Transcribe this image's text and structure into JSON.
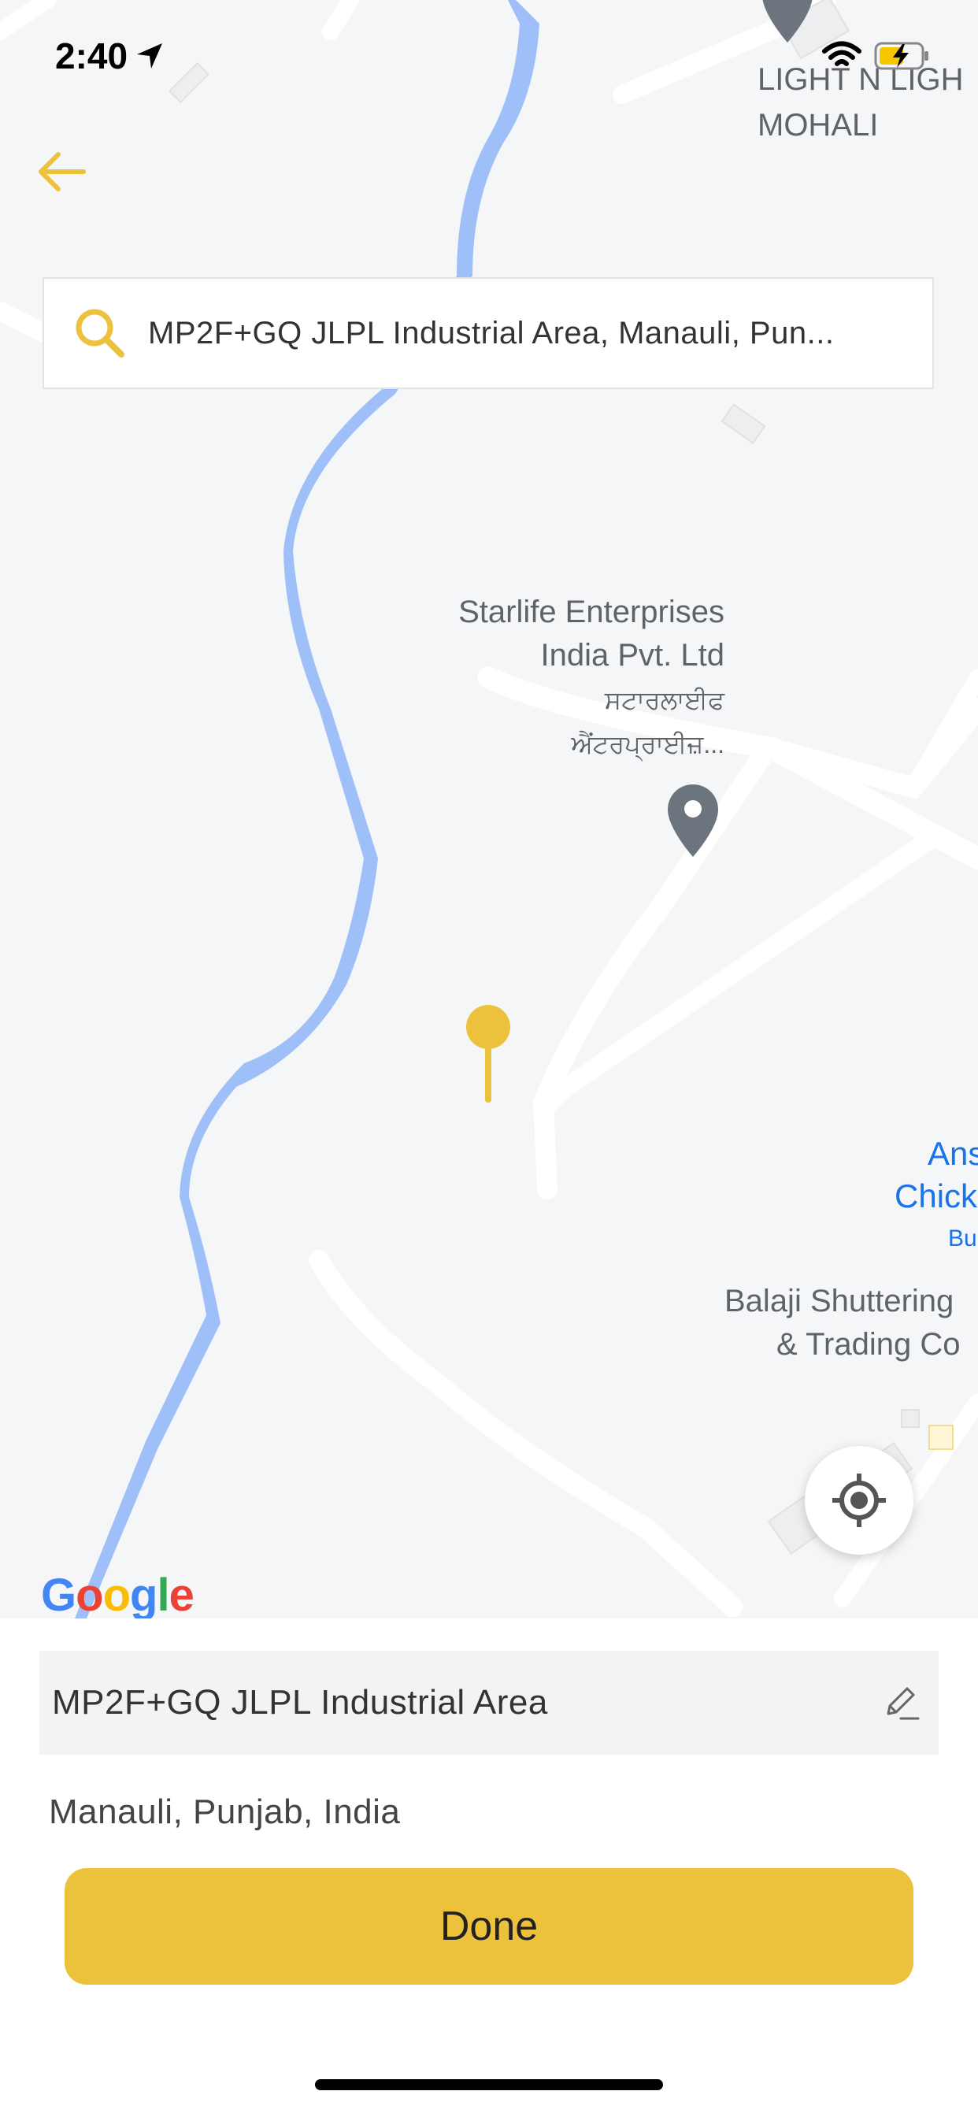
{
  "status_bar": {
    "time": "2:40",
    "location_arrow_icon": "location-arrow-icon",
    "wifi_icon": "wifi-icon",
    "battery_icon": "battery-charging-icon",
    "battery_color": "#f7c600"
  },
  "header": {
    "back_icon": "arrow-left-icon",
    "accent": "#ecc13c"
  },
  "search": {
    "icon": "search-icon",
    "value": "MP2F+GQ JLPL Industrial Area, Manauli, Pun..."
  },
  "map": {
    "labels": {
      "light_n_light": "LIGHT N LIGH",
      "mohali": "MOHALI",
      "starlife_line1": "Starlife Enterprises",
      "starlife_line2": "India Pvt. Ltd",
      "starlife_pa1": "ਸਟਾਰਲਾਈਫ",
      "starlife_pa2": "ਐਂਟਰਪ੍ਰਾਈਜ਼...",
      "ans_line1": "Ans",
      "ans_line2": "Chick",
      "ans_line3": "Bu",
      "balaji_line1": "Balaji Shuttering",
      "balaji_line2": "& Trading Co"
    },
    "river_color": "#9ebff8",
    "road_color": "#ffffff",
    "pin_color": "#ecc13c",
    "poi_color": "#6c757d",
    "locate_icon": "my-location-icon",
    "google_logo": {
      "letters": [
        "G",
        "o",
        "o",
        "g",
        "l",
        "e"
      ],
      "colors": [
        "#4285F4",
        "#EA4335",
        "#FBBC05",
        "#4285F4",
        "#34A853",
        "#EA4335"
      ]
    }
  },
  "address": {
    "line1": "MP2F+GQ JLPL Industrial Area",
    "line2": "Manauli, Punjab, India",
    "edit_icon": "pencil-icon"
  },
  "actions": {
    "done_label": "Done"
  }
}
